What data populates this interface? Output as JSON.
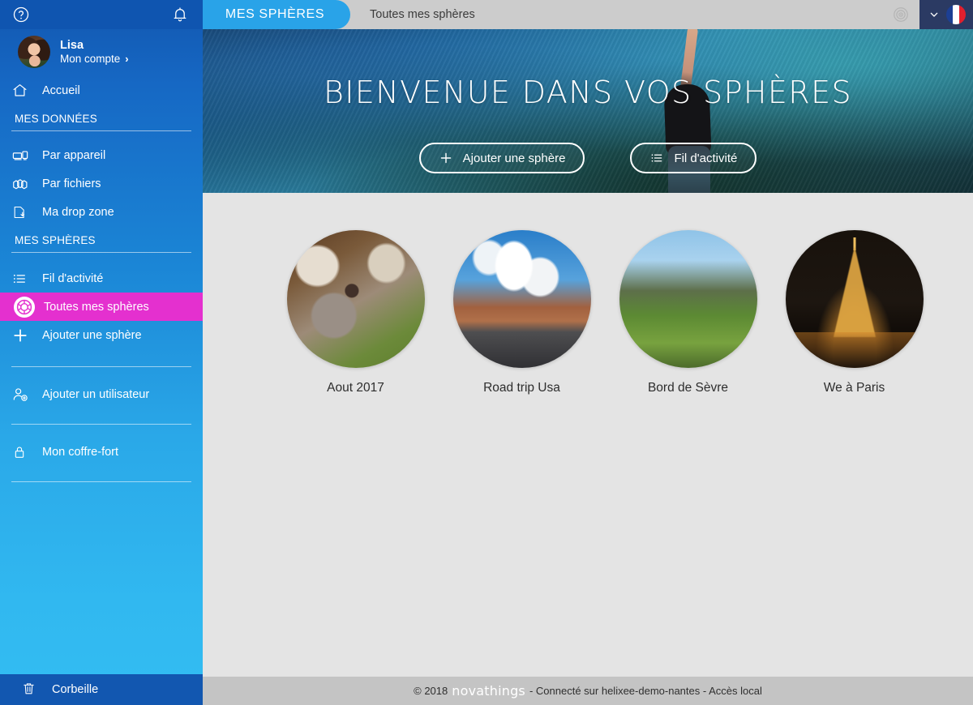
{
  "sidebar": {
    "help_icon": "help-circle-icon",
    "bell_icon": "bell-icon",
    "account": {
      "name": "Lisa",
      "subtitle": "Mon compte",
      "chevron": "›"
    },
    "home": {
      "label": "Accueil",
      "icon": "home-icon"
    },
    "section_data": "MES DONNÉES",
    "data_items": [
      {
        "label": "Par appareil",
        "icon": "devices-icon"
      },
      {
        "label": "Par fichiers",
        "icon": "files-icon"
      },
      {
        "label": "Ma drop zone",
        "icon": "drop-zone-icon"
      }
    ],
    "section_spheres": "MES SPHÈRES",
    "sphere_items": [
      {
        "label": "Fil d'activité",
        "icon": "list-icon",
        "active": false
      },
      {
        "label": "Toutes mes sphères",
        "icon": "sphere-icon",
        "active": true
      },
      {
        "label": "Ajouter une sphère",
        "icon": "plus-icon",
        "active": false
      }
    ],
    "extra_items": [
      {
        "label": "Ajouter un utilisateur",
        "icon": "add-user-icon"
      },
      {
        "label": "Mon coffre-fort",
        "icon": "lock-icon"
      }
    ],
    "trash": {
      "label": "Corbeille",
      "icon": "trash-icon"
    },
    "active_color": "#e430cf"
  },
  "topbar": {
    "tab_label": "MES SPHÈRES",
    "breadcrumb": "Toutes mes sphères",
    "target_icon": "target-icon",
    "chevron_icon": "chevron-down-icon",
    "flag_icon": "flag-fr-icon",
    "tab_color": "#29a3e8"
  },
  "hero": {
    "title": "BIENVENUE DANS VOS SPHÈRES",
    "buttons": [
      {
        "label": "Ajouter une sphère",
        "icon": "plus-icon"
      },
      {
        "label": "Fil d'activité",
        "icon": "list-icon"
      }
    ]
  },
  "spheres": [
    {
      "label": "Aout 2017",
      "thumb": "cow-photo"
    },
    {
      "label": "Road trip Usa",
      "thumb": "desert-road-photo"
    },
    {
      "label": "Bord de Sèvre",
      "thumb": "park-path-photo"
    },
    {
      "label": "We à Paris",
      "thumb": "eiffel-tower-photo"
    }
  ],
  "footer": {
    "copyright": "© 2018",
    "brand": "novathings",
    "status": "- Connecté sur helixee-demo-nantes - Accès local"
  }
}
